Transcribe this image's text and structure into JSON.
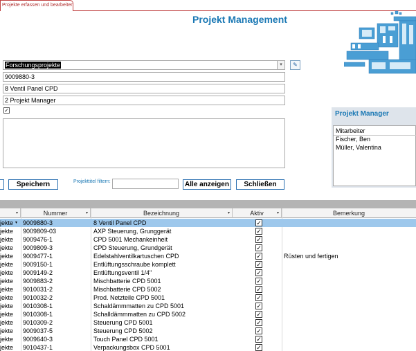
{
  "tab": {
    "label": "Projekte erfassen und bearbeiten"
  },
  "page_title": "Projekt Management",
  "form": {
    "category": "Forschungsprojekte",
    "number": "9009880-3",
    "name": "8 Ventil Panel CPD",
    "manager": "2 Projekt Manager",
    "active_checkbox": "✓",
    "edit_icon": "pencil-icon",
    "dropdown_icon": "chevron-down-icon"
  },
  "buttons": {
    "save": "Speichern",
    "show_all": "Alle anzeigen",
    "close": "Schließen"
  },
  "filter": {
    "label": "Projekttitel filtern:",
    "value": ""
  },
  "manager_panel": {
    "title": "Projekt Manager",
    "header": "Mitarbeiter",
    "items": [
      "Fischer, Ben",
      "Müller, Valentina"
    ]
  },
  "grid": {
    "columns": [
      "Nummer",
      "Bezeichnung",
      "Aktiv",
      "Bemerkung"
    ],
    "sort_icon": "▾",
    "rows": [
      {
        "category": "jekte",
        "number": "9009880-3",
        "name": "8 Ventil Panel CPD",
        "active": "✓",
        "remark": ""
      },
      {
        "category": "jekte",
        "number": "9009809-03",
        "name": "AXP Steuerung, Grunggerät",
        "active": "✓",
        "remark": ""
      },
      {
        "category": "jekte",
        "number": "9009476-1",
        "name": "CPD 5001 Mechankeinheit",
        "active": "✓",
        "remark": ""
      },
      {
        "category": "jekte",
        "number": "9009809-3",
        "name": "CPD Steuerung, Grundgerät",
        "active": "✓",
        "remark": ""
      },
      {
        "category": "jekte",
        "number": "9009477-1",
        "name": "Edelstahlventilkartuschen CPD",
        "active": "✓",
        "remark": "Rüsten und fertigen"
      },
      {
        "category": "jekte",
        "number": "9009150-1",
        "name": "Entlüftungsschraube komplett",
        "active": "✓",
        "remark": ""
      },
      {
        "category": "jekte",
        "number": "9009149-2",
        "name": "Entlüftungsventil 1/4\"",
        "active": "✓",
        "remark": ""
      },
      {
        "category": "jekte",
        "number": "9009883-2",
        "name": "Mischbatterie CPD 5001",
        "active": "✓",
        "remark": ""
      },
      {
        "category": "jekte",
        "number": "9010031-2",
        "name": "Mischbatterie CPD 5002",
        "active": "✓",
        "remark": ""
      },
      {
        "category": "jekte",
        "number": "9010032-2",
        "name": "Prod. Netzteile CPD 5001",
        "active": "✓",
        "remark": ""
      },
      {
        "category": "jekte",
        "number": "9010308-1",
        "name": "Schaldämmmatten zu CPD 5001",
        "active": "✓",
        "remark": ""
      },
      {
        "category": "jekte",
        "number": "9010308-1",
        "name": "Schalldämmmatten zu CPD 5002",
        "active": "✓",
        "remark": ""
      },
      {
        "category": "jekte",
        "number": "9010309-2",
        "name": "Steuerung CPD 5001",
        "active": "✓",
        "remark": ""
      },
      {
        "category": "jekte",
        "number": "9009037-5",
        "name": "Steuerung CPD 5002",
        "active": "✓",
        "remark": ""
      },
      {
        "category": "jekte",
        "number": "9009640-3",
        "name": "Touch Panel CPD 5001",
        "active": "✓",
        "remark": ""
      },
      {
        "category": "jekte",
        "number": "9010437-1",
        "name": "Verpackungsbox CPD 5001",
        "active": "✓",
        "remark": ""
      }
    ]
  },
  "colors": {
    "accent": "#1a78b4",
    "tab_border": "#c04040",
    "selected_row": "#9ec8ec"
  },
  "logo_icon": "machine-illustration-icon"
}
